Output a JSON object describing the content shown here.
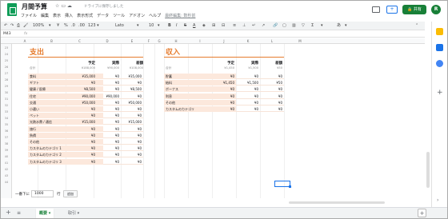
{
  "app": {
    "title": "月間予算",
    "status": "ドライブに保存しました",
    "menu": [
      "ファイル",
      "編集",
      "表示",
      "挿入",
      "表示形式",
      "データ",
      "ツール",
      "アドオン",
      "ヘルプ",
      "最終編集: 数秒前"
    ],
    "share_label": "共有",
    "avatar_letter": "R"
  },
  "toolbar": {
    "zoom": "100%",
    "currency": "¥",
    "percent": "%",
    "decimals_dec": ".0",
    "decimals_inc": ".00",
    "more_formats": "123 ▾",
    "font": "Lato",
    "font_size": "10",
    "bold": "B",
    "italic": "I",
    "strike": "S",
    "text_color": "A",
    "input_tools": "あ"
  },
  "formula_bar": {
    "name_box": "M43",
    "fx": "fx"
  },
  "columns": [
    "A",
    "B",
    "C",
    "D",
    "E",
    "F",
    "G",
    "H",
    "I",
    "J",
    "K",
    "L",
    "M"
  ],
  "rows": [
    "23",
    "24",
    "25",
    "26",
    "27",
    "28",
    "29",
    "30",
    "31",
    "32",
    "33",
    "34",
    "35",
    "36",
    "37",
    "38",
    "39",
    "40",
    "41",
    "42",
    "43",
    "44"
  ],
  "expenses": {
    "title": "支出",
    "headers": [
      "予定",
      "実際",
      "差額"
    ],
    "total_label": "合計",
    "totals": [
      "¥188,000",
      "¥90,000",
      "¥108,000"
    ],
    "items": [
      {
        "label": "食料",
        "plan": "¥35,000",
        "actual": "¥0",
        "diff": "¥35,000"
      },
      {
        "label": "ギフト",
        "plan": "¥0",
        "actual": "¥0",
        "diff": "¥0"
      },
      {
        "label": "健康 / 医療",
        "plan": "¥8,500",
        "actual": "¥0",
        "diff": "¥8,500"
      },
      {
        "label": "住宅",
        "plan": "¥90,000",
        "actual": "¥90,000",
        "diff": "¥0"
      },
      {
        "label": "交通",
        "plan": "¥50,000",
        "actual": "¥0",
        "diff": "¥50,000"
      },
      {
        "label": "小遣い",
        "plan": "¥0",
        "actual": "¥0",
        "diff": "¥0"
      },
      {
        "label": "ペット",
        "plan": "¥0",
        "actual": "¥0",
        "diff": "¥0"
      },
      {
        "label": "光熱水費 / 通信",
        "plan": "¥15,000",
        "actual": "¥0",
        "diff": "¥15,000"
      },
      {
        "label": "旅行",
        "plan": "¥0",
        "actual": "¥0",
        "diff": "¥0"
      },
      {
        "label": "負債",
        "plan": "¥0",
        "actual": "¥0",
        "diff": "¥0"
      },
      {
        "label": "その他",
        "plan": "¥0",
        "actual": "¥0",
        "diff": "¥0"
      },
      {
        "label": "カスタムのカテゴリ 1",
        "plan": "¥0",
        "actual": "¥0",
        "diff": "¥0"
      },
      {
        "label": "カスタムのカテゴリ 2",
        "plan": "¥0",
        "actual": "¥0",
        "diff": "¥0"
      },
      {
        "label": "カスタムのカテゴリ 3",
        "plan": "¥0",
        "actual": "¥0",
        "diff": "¥0"
      }
    ]
  },
  "income": {
    "title": "収入",
    "headers": [
      "予定",
      "実際",
      "差額"
    ],
    "total_label": "合計",
    "totals": [
      "¥1,450",
      "¥1,500",
      "¥50"
    ],
    "items": [
      {
        "label": "貯蓄",
        "plan": "¥0",
        "actual": "¥0",
        "diff": "¥0"
      },
      {
        "label": "給料",
        "plan": "¥1,450",
        "actual": "¥1,500",
        "diff": "¥50"
      },
      {
        "label": "ボーナス",
        "plan": "¥0",
        "actual": "¥0",
        "diff": "¥0"
      },
      {
        "label": "利息",
        "plan": "¥0",
        "actual": "¥0",
        "diff": "¥0"
      },
      {
        "label": "その他",
        "plan": "¥0",
        "actual": "¥0",
        "diff": "¥0"
      },
      {
        "label": "カスタムのカテゴリ",
        "plan": "¥0",
        "actual": "¥0",
        "diff": "¥0"
      }
    ]
  },
  "add_rows": {
    "label": "一番下に",
    "value": "1000",
    "unit": "行",
    "button": "追加"
  },
  "sheets": [
    {
      "label": "概要 ▾",
      "active": true
    },
    {
      "label": "取引 ▾",
      "active": false
    }
  ],
  "colors": {
    "accent": "#e67c2e",
    "row_fill": "#fce8dc",
    "brand_green": "#188038"
  }
}
